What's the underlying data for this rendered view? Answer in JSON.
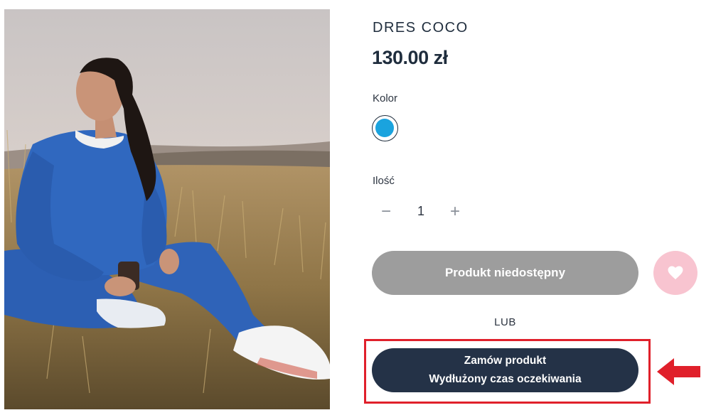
{
  "product": {
    "title": "DRES COCO",
    "price": "130.00 zł",
    "color_label": "Kolor",
    "color_swatch": "#1aa3de",
    "quantity_label": "Ilość",
    "quantity_value": "1",
    "quantity_minus": "−",
    "quantity_plus": "+"
  },
  "actions": {
    "unavailable_label": "Produkt niedostępny",
    "wishlist_icon": "heart-icon",
    "or_label": "LUB",
    "order_line1": "Zamów produkt",
    "order_line2": "Wydłużony czas oczekiwania"
  },
  "annotations": {
    "highlight_color": "#e0202b",
    "arrow_icon": "arrow-left-icon"
  },
  "colors": {
    "primary_dark": "#243247",
    "disabled_gray": "#9d9d9d",
    "wishlist_pink": "#f8c4d0"
  }
}
